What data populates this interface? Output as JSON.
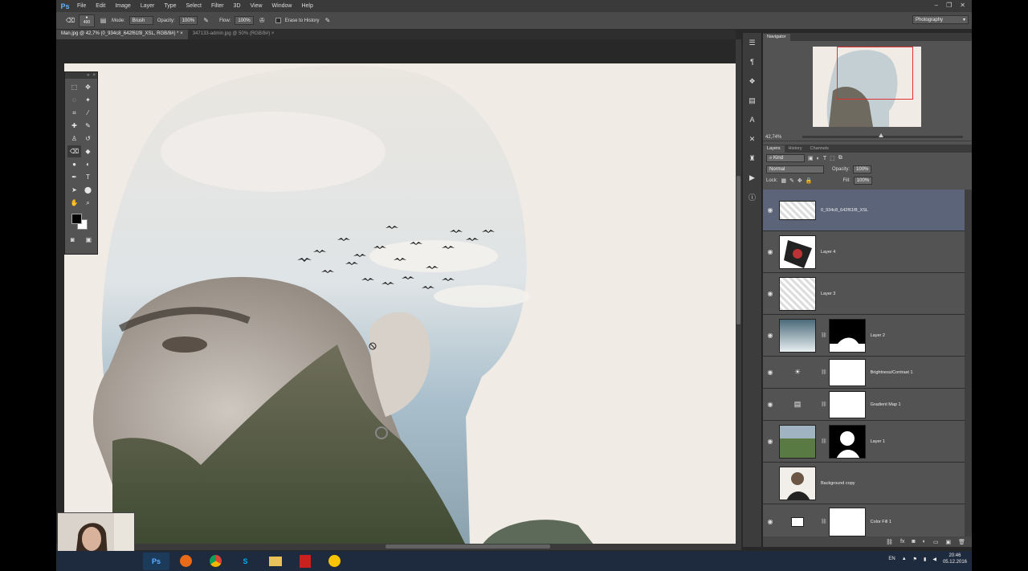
{
  "menubar": {
    "logo": "Ps",
    "items": [
      "File",
      "Edit",
      "Image",
      "Layer",
      "Type",
      "Select",
      "Filter",
      "3D",
      "View",
      "Window",
      "Help"
    ],
    "window_controls": [
      "–",
      "❐",
      "✕"
    ]
  },
  "options_bar": {
    "brush_size": "400",
    "mode_label": "Mode:",
    "mode_value": "Brush",
    "opacity_label": "Opacity:",
    "opacity_value": "100%",
    "flow_label": "Flow:",
    "flow_value": "100%",
    "erase_history_label": "Erase to History",
    "workspace": "Photography"
  },
  "doc_tabs": [
    {
      "label": "Man.jpg @ 42,7% (0_934c8_642f61f8_XSL, RGB/8#) *",
      "close": "×",
      "active": true
    },
    {
      "label": "347133-admin.jpg @ 50% (RGB/8#)",
      "close": "×",
      "active": false
    }
  ],
  "navigator": {
    "tab": "Navigator",
    "zoom": "42,74%"
  },
  "layers_panel": {
    "tabs": [
      "Layers",
      "History",
      "Channels"
    ],
    "kind_label": "Kind",
    "blend_mode": "Normal",
    "opacity_label": "Opacity:",
    "opacity_value": "100%",
    "lock_label": "Lock:",
    "fill_label": "Fill:",
    "fill_value": "100%",
    "layers": [
      {
        "name": "0_934c8_642f61f8_XSL",
        "type": "image",
        "selected": true
      },
      {
        "name": "Layer 4",
        "type": "image"
      },
      {
        "name": "Layer 3",
        "type": "image"
      },
      {
        "name": "Layer 2",
        "type": "masked"
      },
      {
        "name": "Brightness/Contrast 1",
        "type": "adjustment",
        "icon": "sun-icon"
      },
      {
        "name": "Gradient Map 1",
        "type": "adjustment",
        "icon": "gradient-icon"
      },
      {
        "name": "Layer 1",
        "type": "masked"
      },
      {
        "name": "Background copy",
        "type": "image"
      },
      {
        "name": "Color Fill 1",
        "type": "fill"
      }
    ]
  },
  "taskbar": {
    "apps": [
      "Ps",
      "Firefox",
      "Chrome",
      "Skype",
      "Explorer",
      "Acrobat",
      "Norton"
    ],
    "lang": "EN",
    "time": "20:46",
    "date": "05.12.2016"
  },
  "colors": {
    "app_bg": "#282828",
    "panel_bg": "#535353",
    "selected_layer": "#5b6478",
    "canvas_bg": "#f1ebe5",
    "taskbar": "#1e2a3d"
  }
}
